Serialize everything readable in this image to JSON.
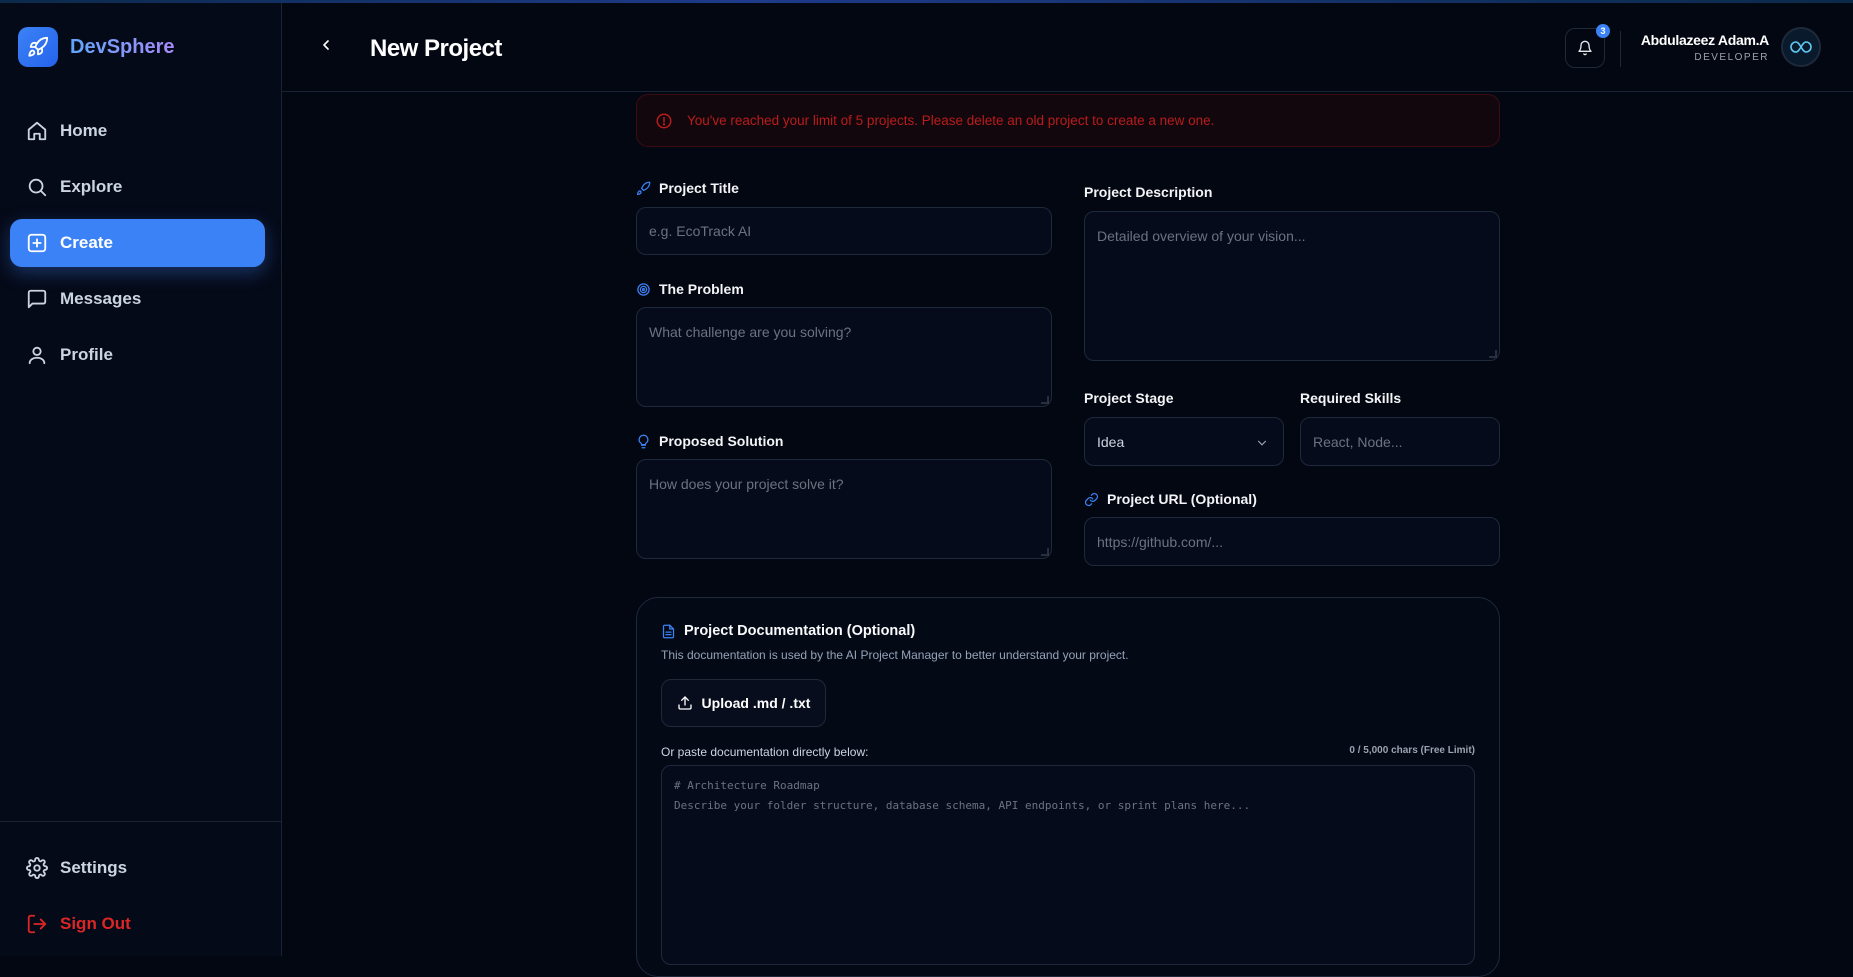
{
  "app": {
    "name": "DevSphere"
  },
  "sidebar": {
    "items": [
      {
        "label": "Home",
        "icon": "home-icon"
      },
      {
        "label": "Explore",
        "icon": "search-icon"
      },
      {
        "label": "Create",
        "icon": "plus-square-icon",
        "active": true
      },
      {
        "label": "Messages",
        "icon": "message-icon"
      },
      {
        "label": "Profile",
        "icon": "user-icon"
      }
    ],
    "bottom": [
      {
        "label": "Settings",
        "icon": "gear-icon"
      },
      {
        "label": "Sign Out",
        "icon": "sign-out-icon"
      }
    ]
  },
  "header": {
    "title": "New Project",
    "notifications": "3",
    "user": {
      "name": "Abdulazeez Adam.A",
      "role": "DEVELOPER"
    }
  },
  "alert": {
    "message": "You've reached your limit of 5 projects. Please delete an old project to create a new one."
  },
  "form": {
    "title": {
      "label": "Project Title",
      "placeholder": "e.g. EcoTrack AI"
    },
    "problem": {
      "label": "The Problem",
      "placeholder": "What challenge are you solving?"
    },
    "solution": {
      "label": "Proposed Solution",
      "placeholder": "How does your project solve it?"
    },
    "description": {
      "label": "Project Description",
      "placeholder": "Detailed overview of your vision..."
    },
    "stage": {
      "label": "Project Stage",
      "value": "Idea"
    },
    "skills": {
      "label": "Required Skills",
      "placeholder": "React, Node..."
    },
    "url": {
      "label": "Project URL (Optional)",
      "placeholder": "https://github.com/..."
    }
  },
  "docs": {
    "title": "Project Documentation (Optional)",
    "subtitle": "This documentation is used by the AI Project Manager to better understand your project.",
    "upload_label": "Upload .md / .txt",
    "paste_label": "Or paste documentation directly below:",
    "char_count": "0 / 5,000 chars (Free Limit)",
    "placeholder_line1": "# Architecture Roadmap",
    "placeholder_line2": "Describe your folder structure, database schema, API endpoints, or sprint plans here..."
  },
  "colors": {
    "accent": "#3b82f6",
    "danger": "#dc2626",
    "background": "#030712"
  }
}
